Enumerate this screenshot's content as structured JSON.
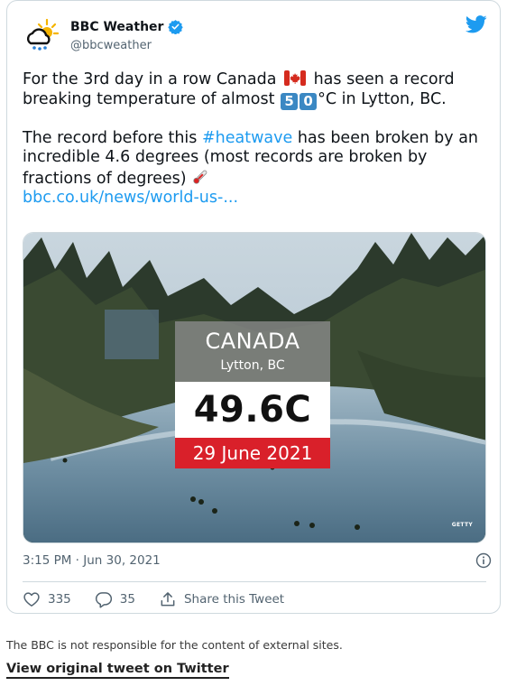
{
  "tweet": {
    "author_name": "BBC Weather",
    "handle": "@bbcweather",
    "line1_pre": "For the 3rd day in a row Canada",
    "line1_post": "has seen a record breaking temperature of almost",
    "digit_5": "5",
    "digit_0": "0",
    "line1_end": "°C in Lytton, BC.",
    "line2_pre": "The record before this",
    "hashtag": "#heatwave",
    "line2_post": "has been broken by an incredible 4.6 degrees (most records are broken by fractions of degrees)",
    "link": "bbc.co.uk/news/world-us-...",
    "timestamp": "3:15 PM · Jun 30, 2021"
  },
  "media": {
    "country": "CANADA",
    "location": "Lytton, BC",
    "temperature": "49.6C",
    "date": "29 June 2021",
    "credit": "GETTY"
  },
  "actions": {
    "likes": "335",
    "replies": "35",
    "share_label": "Share this Tweet"
  },
  "footer": {
    "disclaimer": "The BBC is not responsible for the content of external sites.",
    "view_link": "View original tweet on Twitter"
  },
  "colors": {
    "link_blue": "#1d9bf0",
    "date_red": "#d9202a",
    "keycap_blue": "#3b88c3"
  },
  "icons": [
    "bbc-weather-logo-icon",
    "verified-badge-icon",
    "twitter-bird-icon",
    "canada-flag-icon",
    "thermometer-icon",
    "info-icon",
    "heart-icon",
    "reply-icon",
    "share-icon"
  ]
}
